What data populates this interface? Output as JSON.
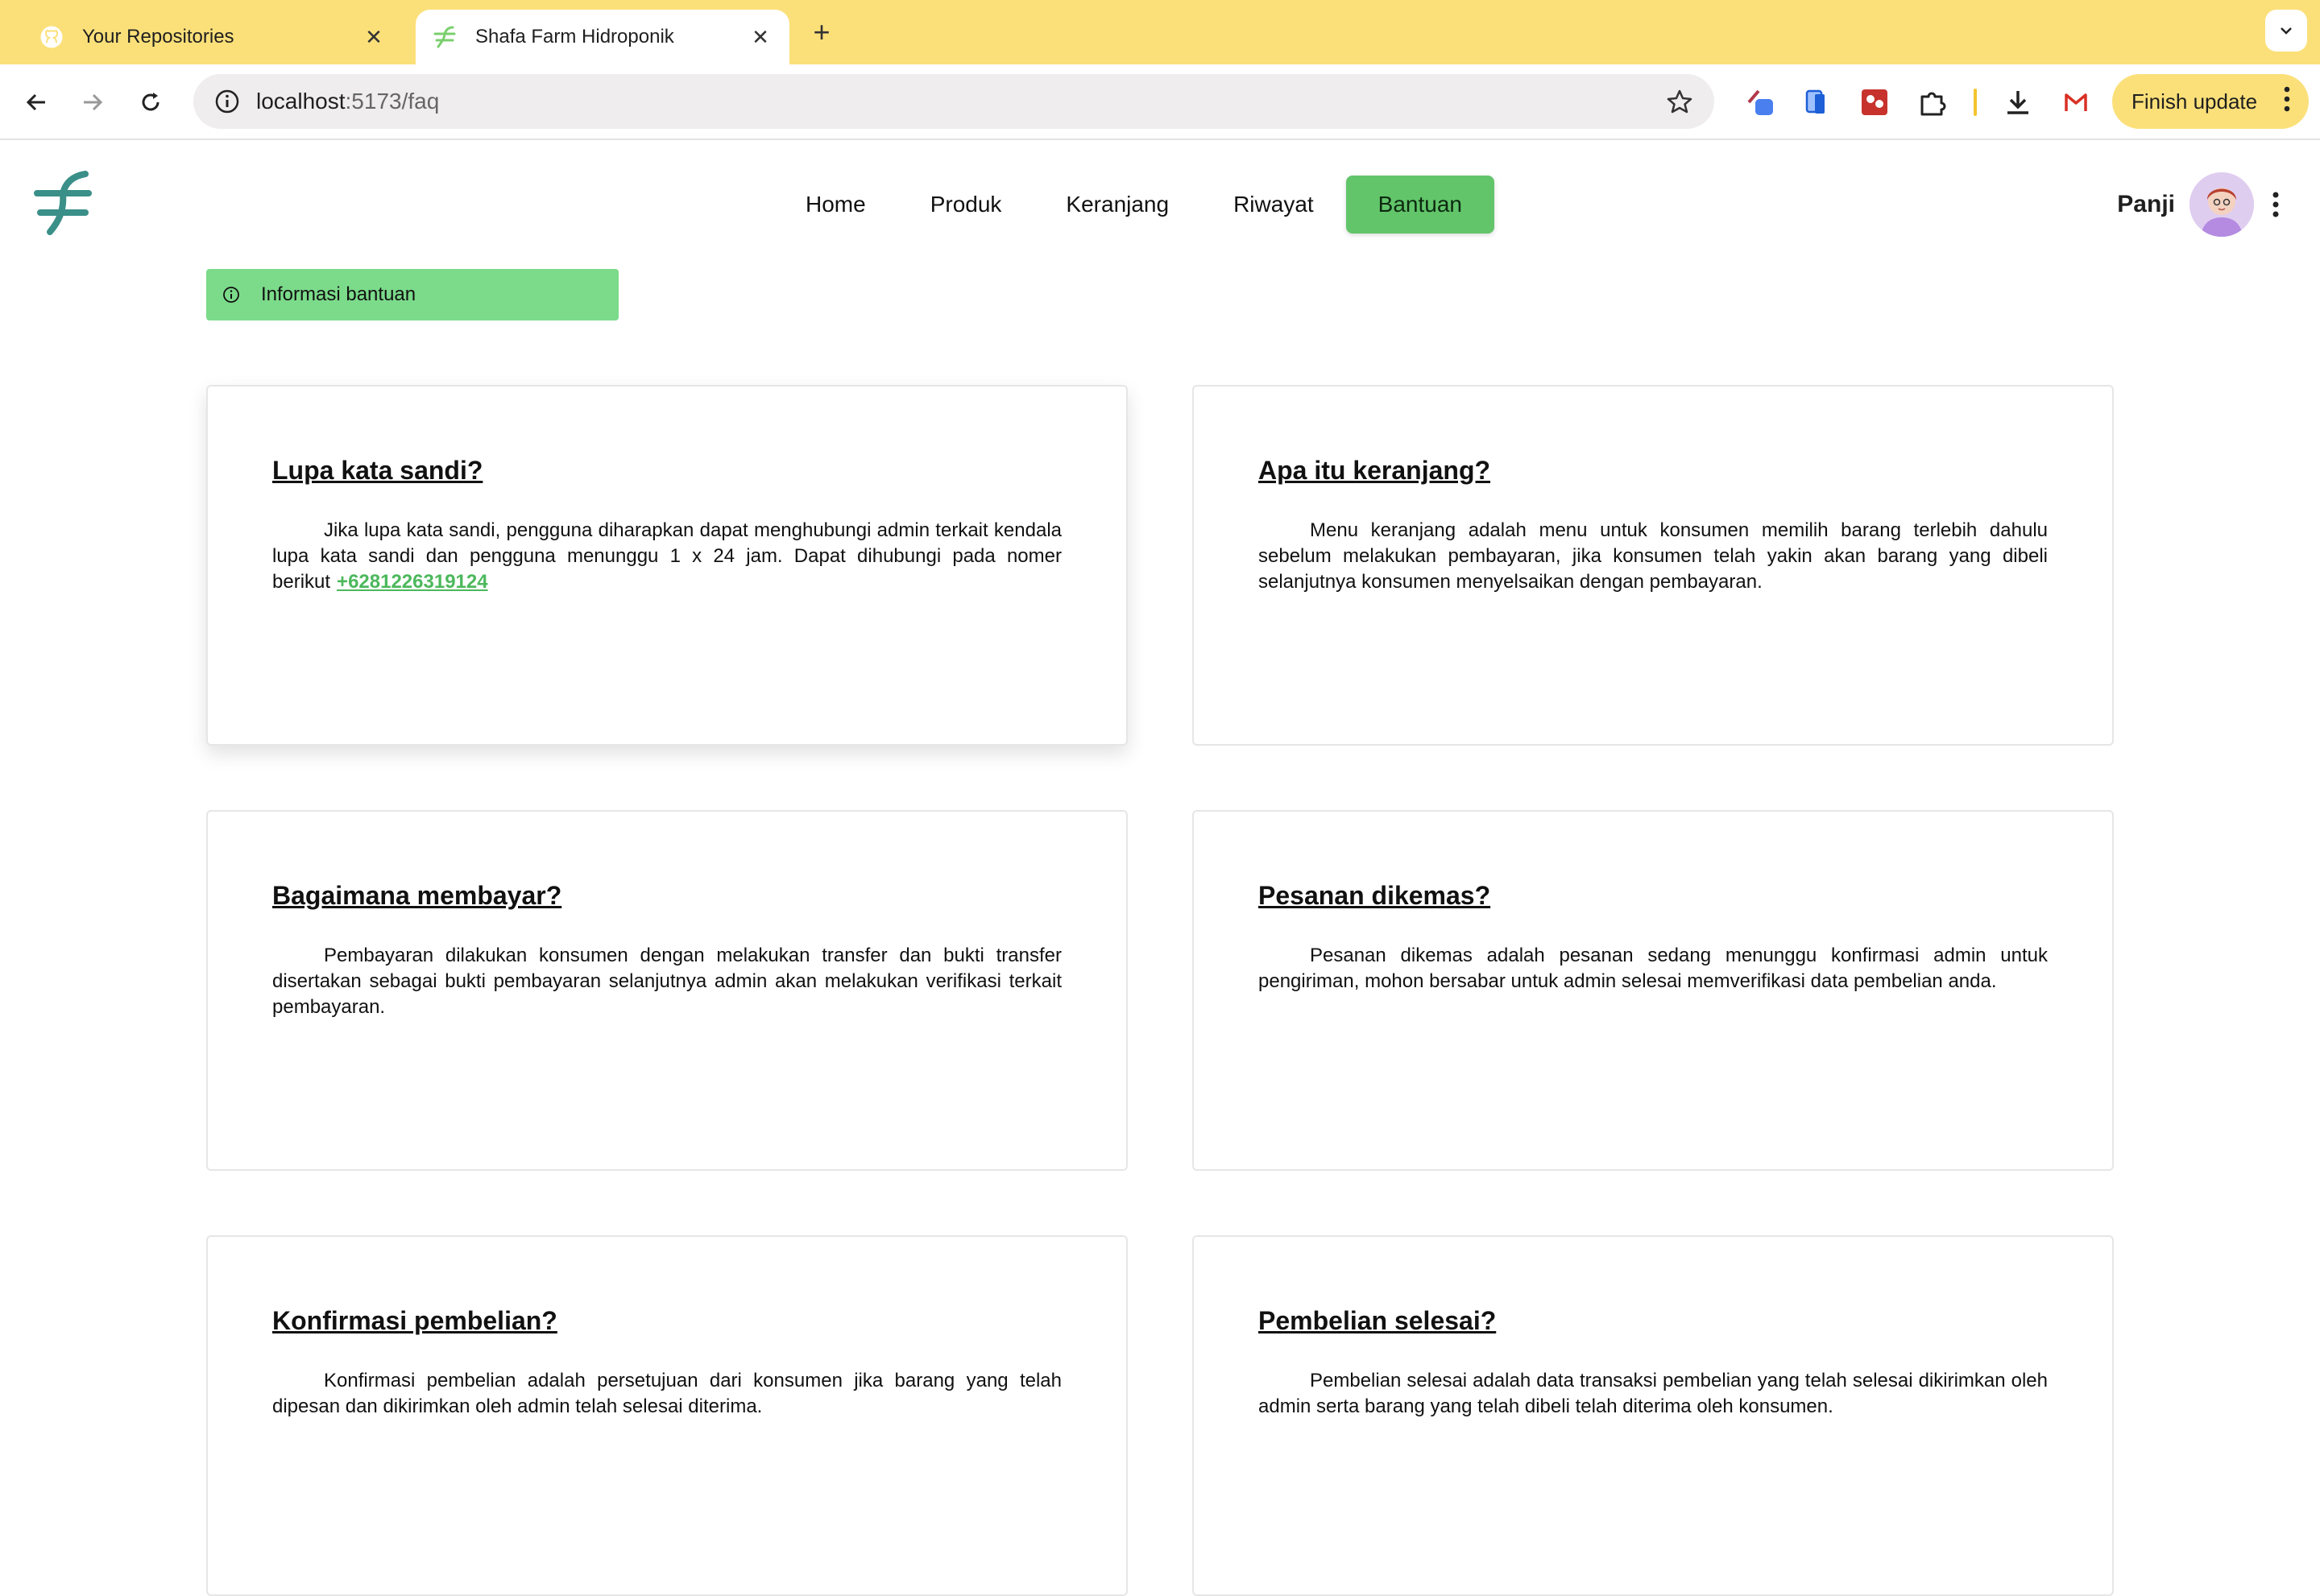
{
  "browser": {
    "tabs": [
      {
        "title": "Your Repositories",
        "icon": "github-icon"
      },
      {
        "title": "Shafa Farm Hidroponik",
        "icon": "shafa-farm-favicon"
      }
    ],
    "url_host": "localhost",
    "url_path": ":5173/faq",
    "finish_update_label": "Finish update"
  },
  "header": {
    "nav": [
      "Home",
      "Produk",
      "Keranjang",
      "Riwayat",
      "Bantuan"
    ],
    "active_nav": "Bantuan",
    "username": "Panji"
  },
  "info_label": "Informasi bantuan",
  "faq": [
    {
      "question": "Lupa kata sandi?",
      "answer": "Jika lupa kata sandi, pengguna diharapkan dapat menghubungi admin terkait kendala lupa kata sandi dan pengguna menunggu 1 x 24 jam. Dapat dihubungi pada nomer berikut",
      "phone": "+6281226319124"
    },
    {
      "question": "Apa itu keranjang?",
      "answer": "Menu keranjang adalah menu untuk konsumen memilih barang terlebih dahulu sebelum melakukan pembayaran, jika konsumen telah yakin akan barang yang dibeli selanjutnya konsumen menyelsaikan dengan pembayaran."
    },
    {
      "question": "Bagaimana membayar?",
      "answer": "Pembayaran dilakukan konsumen dengan melakukan transfer dan bukti transfer disertakan sebagai bukti pembayaran selanjutnya admin akan melakukan verifikasi terkait pembayaran."
    },
    {
      "question": "Pesanan dikemas?",
      "answer": "Pesanan dikemas adalah pesanan sedang menunggu konfirmasi admin untuk pengiriman, mohon bersabar untuk admin selesai memverifikasi data pembelian anda."
    },
    {
      "question": "Konfirmasi pembelian?",
      "answer": "Konfirmasi pembelian adalah persetujuan dari konsumen jika barang yang telah dipesan dan dikirimkan oleh admin telah selesai diterima."
    },
    {
      "question": "Pembelian selesai?",
      "answer": "Pembelian selesai adalah data transaksi pembelian yang telah selesai dikirimkan oleh admin serta barang yang telah dibeli telah diterima oleh konsumen."
    }
  ],
  "colors": {
    "accent": "#62c56a",
    "info_bar": "#7bdb8a",
    "tabstrip": "#fbe07a",
    "link": "#4cb85c",
    "logo": "#3a8f89"
  }
}
